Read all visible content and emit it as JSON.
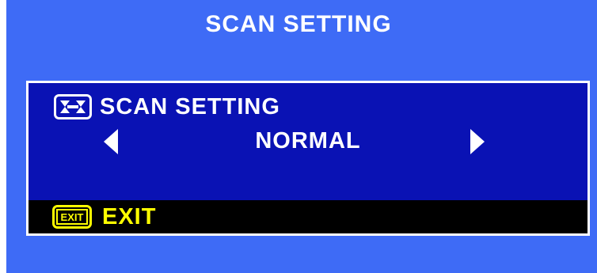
{
  "menu": {
    "title": "SCAN SETTING",
    "colors": {
      "outer_background": "#3e6bf6",
      "dialog_background": "#0a12b4",
      "dialog_border": "#ffffff",
      "exit_bar_background": "#000000",
      "exit_text": "#ffff00",
      "text": "#ffffff"
    }
  },
  "setting": {
    "icon": "scan-setting-icon",
    "label": "SCAN SETTING",
    "value": "NORMAL",
    "prev_icon": "arrow-left-icon",
    "next_icon": "arrow-right-icon"
  },
  "exit": {
    "icon_text": "EXIT",
    "label": "EXIT"
  }
}
